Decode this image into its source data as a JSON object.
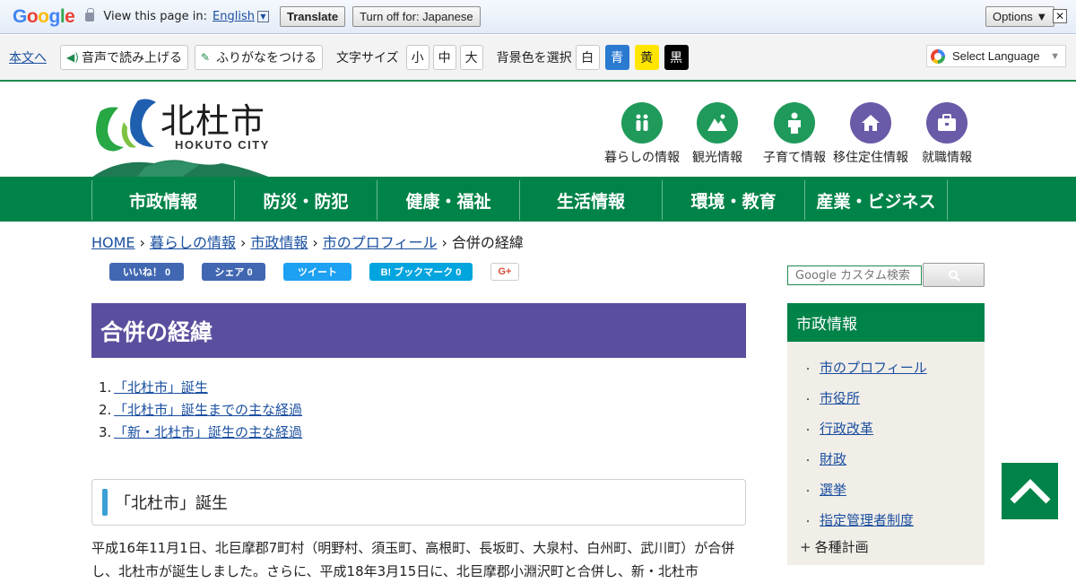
{
  "translate_bar": {
    "logo": [
      "G",
      "o",
      "o",
      "g",
      "l",
      "e"
    ],
    "prompt": "View this page in:",
    "language": "English",
    "translate_label": "Translate",
    "turn_off_label": "Turn off for: Japanese",
    "options_label": "Options ▼",
    "close_label": "✕"
  },
  "toolbar": {
    "skip_link": "本文へ",
    "read_aloud": "音声で読み上げる",
    "furigana": "ふりがなをつける",
    "font_size_label": "文字サイズ",
    "font_sizes": [
      "小",
      "中",
      "大"
    ],
    "bg_color_label": "背景色を選択",
    "bg_colors": [
      {
        "label": "白",
        "bg": "#ffffff",
        "fg": "#222222"
      },
      {
        "label": "青",
        "bg": "#2a7ad2",
        "fg": "#ffffff"
      },
      {
        "label": "黄",
        "bg": "#ffe600",
        "fg": "#222222"
      },
      {
        "label": "黒",
        "bg": "#000000",
        "fg": "#ffffff"
      }
    ],
    "select_language": "Select Language",
    "select_caret": "▼"
  },
  "header": {
    "site_title": "北杜市",
    "site_subtitle": "HOKUTO CITY",
    "quick_links": [
      {
        "label": "暮らしの情報",
        "icon": "family-icon",
        "color": "#1f9a5a"
      },
      {
        "label": "観光情報",
        "icon": "mountain-icon",
        "color": "#1f9a5a"
      },
      {
        "label": "子育て情報",
        "icon": "child-icon",
        "color": "#1f9a5a"
      },
      {
        "label": "移住定住情報",
        "icon": "house-icon",
        "color": "#6a5aa8"
      },
      {
        "label": "就職情報",
        "icon": "briefcase-icon",
        "color": "#6a5aa8"
      }
    ]
  },
  "global_nav": [
    "市政情報",
    "防災・防犯",
    "健康・福祉",
    "生活情報",
    "環境・教育",
    "産業・ビジネス"
  ],
  "breadcrumb": {
    "links": [
      "HOME",
      "暮らしの情報",
      "市政情報",
      "市のプロフィール"
    ],
    "current": "合併の経緯",
    "separator": "›"
  },
  "social": {
    "like": "いいね！ 0",
    "share": "シェア 0",
    "tweet": "ツイート",
    "bookmark": "B! ブックマーク  0",
    "gplus": "G+"
  },
  "search": {
    "placeholder": "Google カスタム検索"
  },
  "main": {
    "title": "合併の経緯",
    "toc": [
      {
        "num": "1.",
        "label": "「北杜市」誕生"
      },
      {
        "num": "2.",
        "label": "「北杜市」誕生までの主な経過"
      },
      {
        "num": "3.",
        "label": "「新・北杜市」誕生の主な経過"
      }
    ],
    "section_title": "「北杜市」誕生",
    "body": "平成16年11月1日、北巨摩郡7町村（明野村、須玉町、高根町、長坂町、大泉村、白州町、武川町）が合併し、北杜市が誕生しました。さらに、平成18年3月15日に、北巨摩郡小淵沢町と合併し、新・北杜市"
  },
  "sidebar": {
    "heading": "市政情報",
    "items": [
      "市のプロフィール",
      "市役所",
      "行政改革",
      "財政",
      "選挙",
      "指定管理者制度"
    ],
    "expandable": "各種計画",
    "bullet": "・",
    "plus": "+"
  },
  "colors": {
    "nav_green": "#008348",
    "heading_purple": "#5a4f9e",
    "accent_blue": "#3aa0d5"
  }
}
